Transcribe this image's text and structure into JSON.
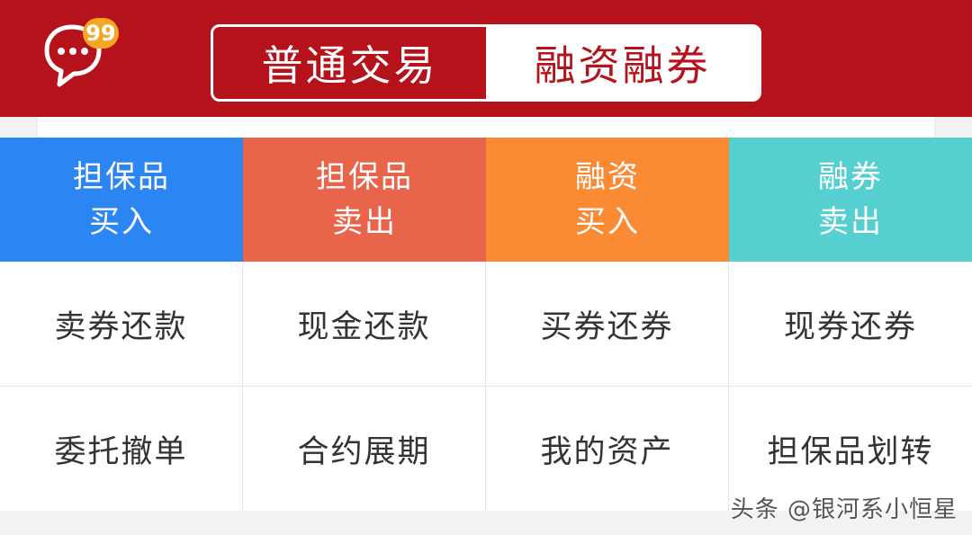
{
  "header": {
    "message_badge": "99",
    "tabs": [
      {
        "label": "普通交易",
        "active": true
      },
      {
        "label": "融资融券",
        "active": false
      }
    ]
  },
  "actions": [
    {
      "line1": "担保品",
      "line2": "买入",
      "color": "#2b86f3"
    },
    {
      "line1": "担保品",
      "line2": "卖出",
      "color": "#e8654c"
    },
    {
      "line1": "融资",
      "line2": "买入",
      "color": "#fb8a35"
    },
    {
      "line1": "融券",
      "line2": "卖出",
      "color": "#55cfd0"
    }
  ],
  "functions_row1": [
    "卖券还款",
    "现金还款",
    "买券还券",
    "现券还券"
  ],
  "functions_row2": [
    "委托撤单",
    "合约展期",
    "我的资产",
    "担保品划转"
  ],
  "watermark": "头条 @银河系小恒星",
  "colors": {
    "header_red": "#b5121b",
    "badge_orange": "#f5a623"
  }
}
